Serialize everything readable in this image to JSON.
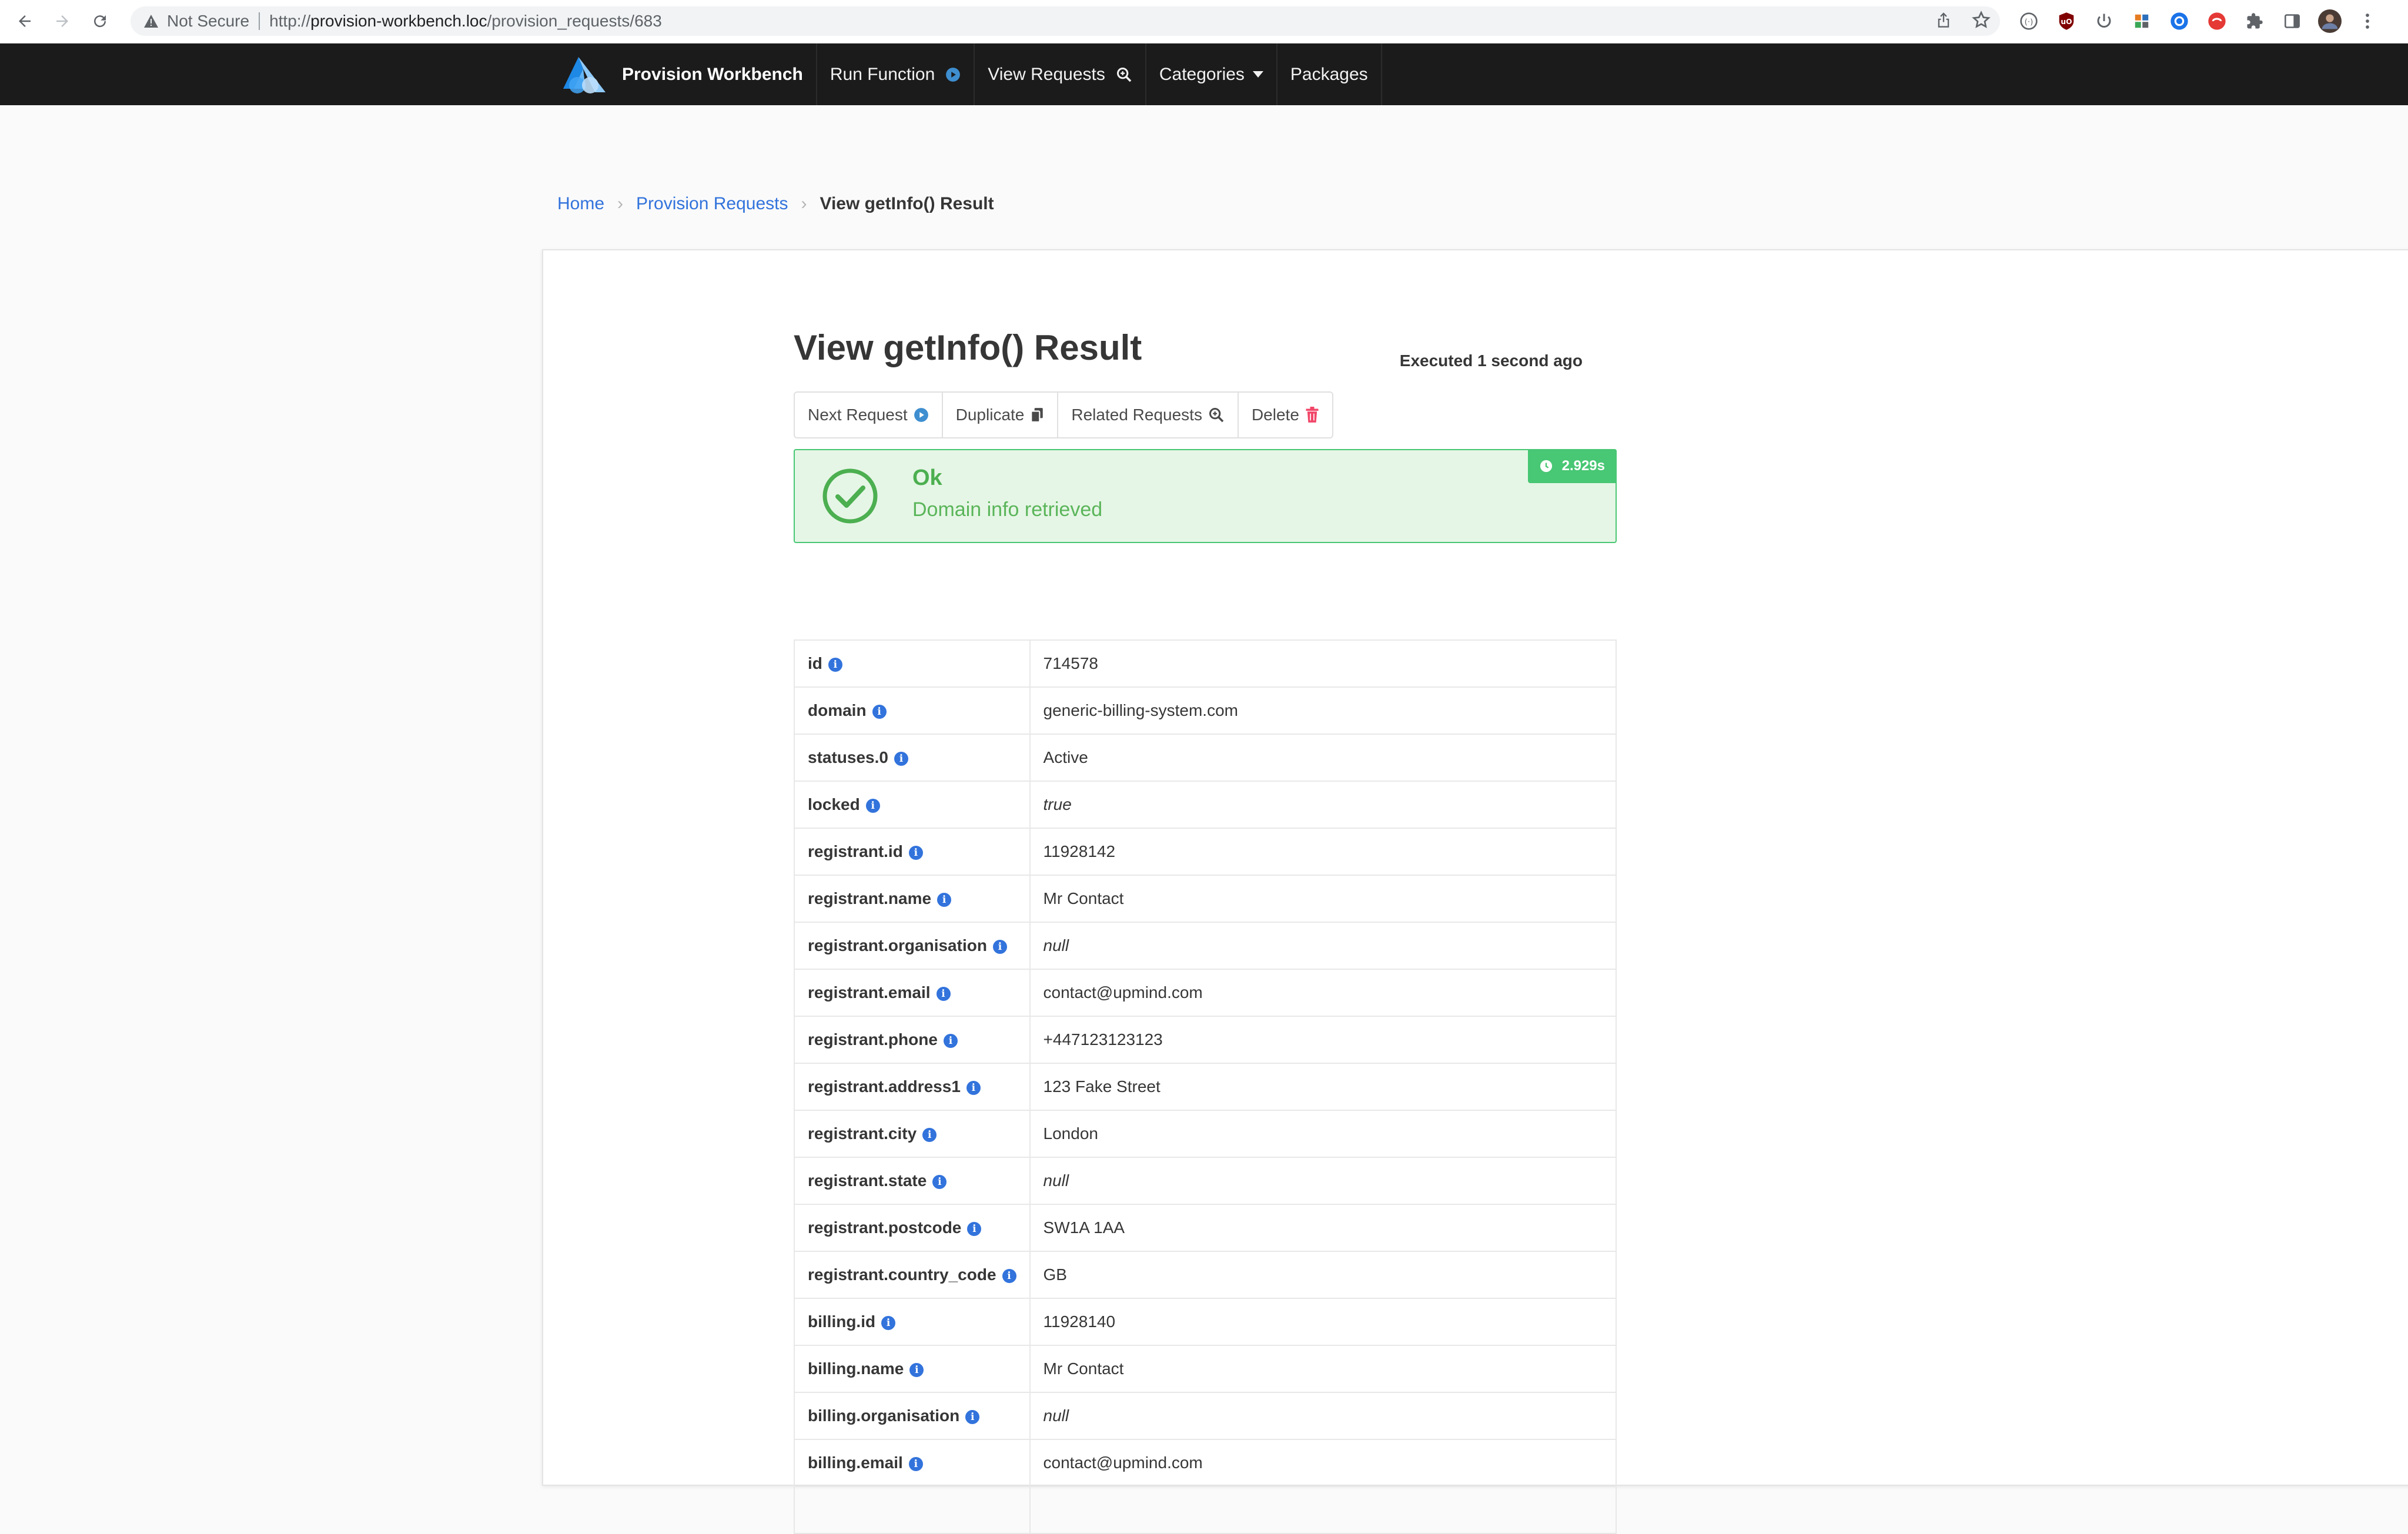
{
  "browser": {
    "security_label": "Not Secure",
    "url_prefix": "http://",
    "url_host": "provision-workbench.loc",
    "url_path": "/provision_requests/683"
  },
  "navbar": {
    "brand": "Provision Workbench",
    "items": [
      {
        "label": "Run Function",
        "icon": "play-circle-icon"
      },
      {
        "label": "View Requests",
        "icon": "search-icon"
      },
      {
        "label": "Categories",
        "icon": "chevron-down-icon"
      },
      {
        "label": "Packages"
      }
    ]
  },
  "breadcrumb": {
    "home": "Home",
    "section": "Provision Requests",
    "current": "View getInfo() Result",
    "separator": "›"
  },
  "page": {
    "title": "View getInfo() Result",
    "executed": "Executed 1 second ago"
  },
  "actions": {
    "next": "Next Request",
    "duplicate": "Duplicate",
    "related": "Related Requests",
    "delete": "Delete"
  },
  "status": {
    "title": "Ok",
    "message": "Domain info retrieved",
    "duration": "2.929s",
    "color": "#48c774"
  },
  "rows": [
    {
      "key": "id",
      "value": "714578"
    },
    {
      "key": "domain",
      "value": "generic-billing-system.com"
    },
    {
      "key": "statuses.0",
      "value": "Active"
    },
    {
      "key": "locked",
      "value": "true",
      "italic": true
    },
    {
      "key": "registrant.id",
      "value": "11928142"
    },
    {
      "key": "registrant.name",
      "value": "Mr Contact"
    },
    {
      "key": "registrant.organisation",
      "value": "null",
      "italic": true
    },
    {
      "key": "registrant.email",
      "value": "contact@upmind.com"
    },
    {
      "key": "registrant.phone",
      "value": "+447123123123"
    },
    {
      "key": "registrant.address1",
      "value": "123 Fake Street"
    },
    {
      "key": "registrant.city",
      "value": "London"
    },
    {
      "key": "registrant.state",
      "value": "null",
      "italic": true
    },
    {
      "key": "registrant.postcode",
      "value": "SW1A 1AA"
    },
    {
      "key": "registrant.country_code",
      "value": "GB"
    },
    {
      "key": "billing.id",
      "value": "11928140"
    },
    {
      "key": "billing.name",
      "value": "Mr Contact"
    },
    {
      "key": "billing.organisation",
      "value": "null",
      "italic": true
    },
    {
      "key": "billing.email",
      "value": "contact@upmind.com"
    },
    {
      "key": "",
      "value": ""
    }
  ]
}
